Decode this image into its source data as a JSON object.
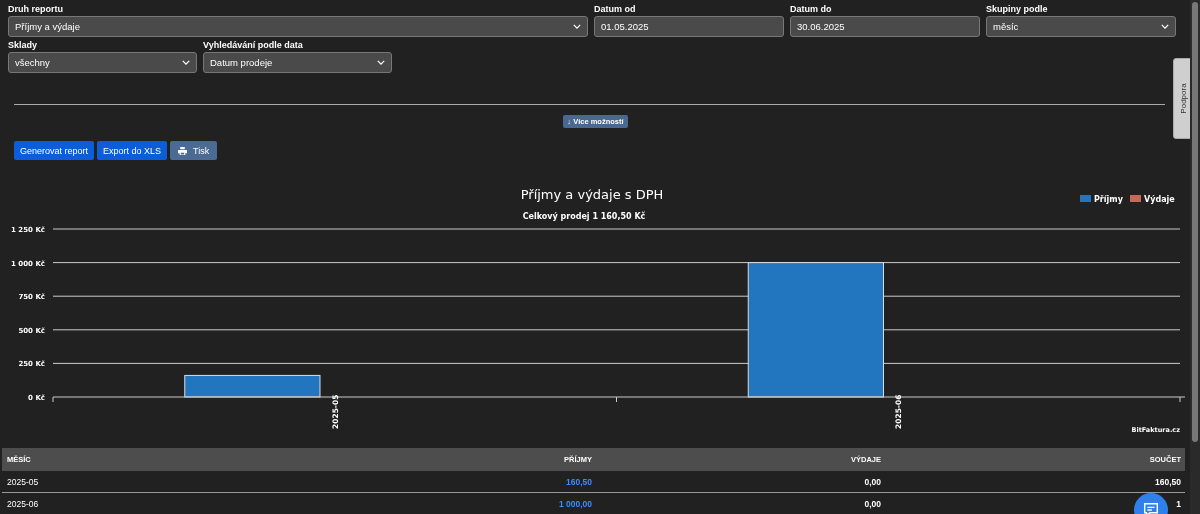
{
  "filters": [
    {
      "label": "Druh reportu",
      "value": "Příjmy a výdaje",
      "kind": "select"
    },
    {
      "label": "Datum od",
      "value": "01.05.2025",
      "kind": "input"
    },
    {
      "label": "Datum do",
      "value": "30.06.2025",
      "kind": "input"
    },
    {
      "label": "Skupiny podle",
      "value": "měsíc",
      "kind": "select"
    },
    {
      "label": "Sklady",
      "value": "všechny",
      "kind": "select"
    },
    {
      "label": "Vyhledávání podle data",
      "value": "Datum prodeje",
      "kind": "select"
    }
  ],
  "more_button": "↓ Více možností",
  "actions": [
    {
      "label": "Generovat report",
      "kind": "primary"
    },
    {
      "label": "Export do XLS",
      "kind": "primary"
    },
    {
      "label": "Tisk",
      "kind": "print"
    }
  ],
  "support_tab": "Podpora",
  "chart": {
    "credit": "BitFaktura.cz",
    "chart_data": {
      "type": "bar",
      "title": "Příjmy a výdaje s DPH",
      "subtitle": "Celkový prodej 1 160,50 Kč",
      "categories": [
        "2025-05",
        "2025-06"
      ],
      "series": [
        {
          "name": "Příjmy",
          "color": "#2276c0",
          "values": [
            160.5,
            1000
          ]
        },
        {
          "name": "Výdaje",
          "color": "#c56a59",
          "values": [
            0,
            0
          ]
        }
      ],
      "ylim": [
        0,
        1250
      ],
      "grid": true,
      "yticks": [
        {
          "value": 0,
          "label": "0 Kč"
        },
        {
          "value": 250,
          "label": "250 Kč"
        },
        {
          "value": 500,
          "label": "500 Kč"
        },
        {
          "value": 750,
          "label": "750 Kč"
        },
        {
          "value": 1000,
          "label": "1 000 Kč"
        },
        {
          "value": 1250,
          "label": "1 250 Kč"
        }
      ]
    }
  },
  "table": {
    "columns": [
      "MĚSÍC",
      "PŘÍJMY",
      "VÝDAJE",
      "SOUČET"
    ],
    "rows": [
      [
        "2025-05",
        "160,50",
        "0,00",
        "160,50"
      ],
      [
        "2025-06",
        "1 000,00",
        "0,00",
        "1"
      ]
    ]
  }
}
